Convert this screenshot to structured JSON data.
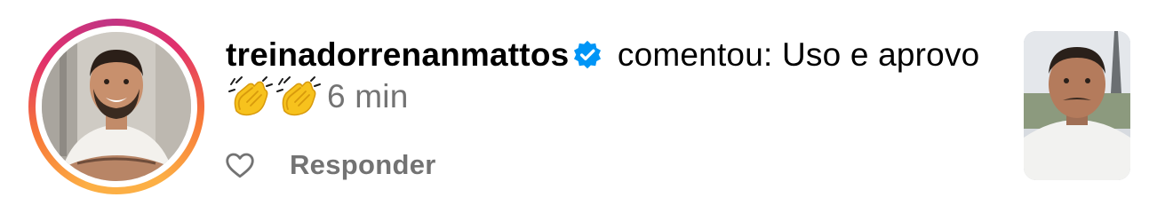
{
  "notification": {
    "username": "treinadorrenanmattos",
    "verified": true,
    "action_text": " comentou: Uso e aprovo ",
    "time": "6 min",
    "emoji": "clapping-hands",
    "reply_label": "Responder"
  },
  "colors": {
    "verified_blue": "#0095f6",
    "secondary_text": "#737373",
    "ring_start": "#fcaf45",
    "ring_end": "#c13584"
  }
}
